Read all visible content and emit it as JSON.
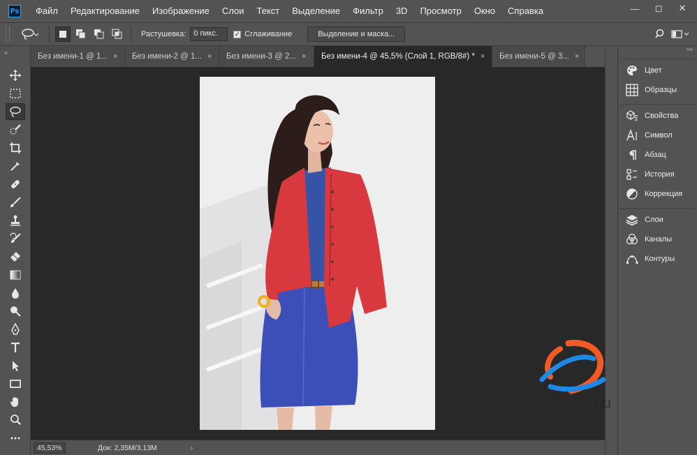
{
  "app": {
    "logo": "Ps"
  },
  "menu": [
    "Файл",
    "Редактирование",
    "Изображение",
    "Слои",
    "Текст",
    "Выделение",
    "Фильтр",
    "3D",
    "Просмотр",
    "Окно",
    "Справка"
  ],
  "window_controls": {
    "minimize": "—",
    "maximize": "◻",
    "close": "✕"
  },
  "options": {
    "feather_label": "Растушевка:",
    "feather_value": "0 пикс.",
    "antialias_label": "Сглаживание",
    "antialias_checked": true,
    "select_mask_button": "Выделение и маска..."
  },
  "tabs": [
    {
      "label": "Без имени-1 @ 1...",
      "close": "×"
    },
    {
      "label": "Без имени-2 @ 1...",
      "close": "×"
    },
    {
      "label": "Без имени-3 @ 2...",
      "close": "×"
    },
    {
      "label": "Без имени-4 @ 45,5% (Слой 1, RGB/8#) *",
      "close": "×"
    },
    {
      "label": "Без имени-5 @ 3...",
      "close": "×"
    }
  ],
  "active_tab_index": 3,
  "tools": [
    "move-tool",
    "marquee-tool",
    "lasso-tool",
    "quick-selection-tool",
    "crop-tool",
    "eyedropper-tool",
    "healing-brush-tool",
    "brush-tool",
    "clone-stamp-tool",
    "history-brush-tool",
    "eraser-tool",
    "gradient-tool",
    "blur-tool",
    "dodge-tool",
    "pen-tool",
    "type-tool",
    "path-selection-tool",
    "rectangle-tool",
    "hand-tool",
    "zoom-tool",
    "more-tools"
  ],
  "active_tool": "lasso-tool",
  "status": {
    "zoom": "45,53%",
    "doc_info": "Док: 2,35M/3,13M",
    "arrow": "›"
  },
  "panels": {
    "group1": [
      {
        "label": "Цвет",
        "icon": "palette-icon"
      },
      {
        "label": "Образцы",
        "icon": "swatches-icon"
      }
    ],
    "group2": [
      {
        "label": "Свойства",
        "icon": "properties-icon"
      },
      {
        "label": "Символ",
        "icon": "character-icon"
      },
      {
        "label": "Абзац",
        "icon": "paragraph-icon"
      },
      {
        "label": "История",
        "icon": "history-icon"
      },
      {
        "label": "Коррекция",
        "icon": "adjustments-icon"
      }
    ],
    "group3": [
      {
        "label": "Слои",
        "icon": "layers-icon"
      },
      {
        "label": "Каналы",
        "icon": "channels-icon"
      },
      {
        "label": "Контуры",
        "icon": "paths-icon"
      }
    ]
  },
  "watermark": {
    "text": "WamOtvet.ru"
  },
  "colors": {
    "accent_orange": "#f15a24",
    "accent_blue": "#1e88e5",
    "ps_blue": "#31a8ff"
  }
}
